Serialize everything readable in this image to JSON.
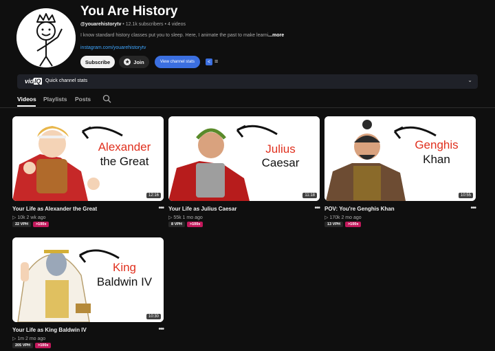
{
  "channel": {
    "name": "You Are History",
    "handle": "@youarehistorytv",
    "stats": "• 12.1k subscribers • 4 videos",
    "description": "I know standard history classes put you to sleep. Here, I animate the past to make learni",
    "more_label": "...more",
    "link": "instagram.com/youarehistorytv"
  },
  "buttons": {
    "subscribe": "Subscribe",
    "join": "Join",
    "view_stats": "View channel stats"
  },
  "vidiq": {
    "logo_vid": "vid",
    "logo_iq": "IQ",
    "label": "Quick channel stats",
    "chevron": "⌄"
  },
  "tabs": [
    {
      "label": "Videos"
    },
    {
      "label": "Playlists"
    },
    {
      "label": "Posts"
    }
  ],
  "videos": [
    {
      "title": "Your Life as Alexander the Great",
      "thumb_line1": "Alexander",
      "thumb_line2": "the Great",
      "duration": "12:16",
      "meta": "▷ 10k  2 wk ago",
      "vph": "22 VPH",
      "badge": ">100x"
    },
    {
      "title": "Your Life as Julius Caesar",
      "thumb_line1": "Julius",
      "thumb_line2": "Caesar",
      "duration": "11:18",
      "meta": "▷ 55k  1 mo ago",
      "vph": "8 VPH",
      "badge": ">100x"
    },
    {
      "title": "POV: You're Genghis Khan",
      "thumb_line1": "Genghis",
      "thumb_line2": "Khan",
      "duration": "10:55",
      "meta": "▷ 170k  2 mo ago",
      "vph": "13 VPH",
      "badge": ">100x"
    },
    {
      "title": "Your Life as King Baldwin IV",
      "thumb_line1": "King",
      "thumb_line2": "Baldwin IV",
      "duration": "10:30",
      "meta": "▷ 1m  2 mo ago",
      "vph": "205 VPH",
      "badge": ">100x"
    }
  ],
  "colors": {
    "accent_red": "#e0301e",
    "badge_pink": "#c2185b",
    "stats_blue": "#3b6fe0",
    "link_blue": "#3ea6ff"
  }
}
